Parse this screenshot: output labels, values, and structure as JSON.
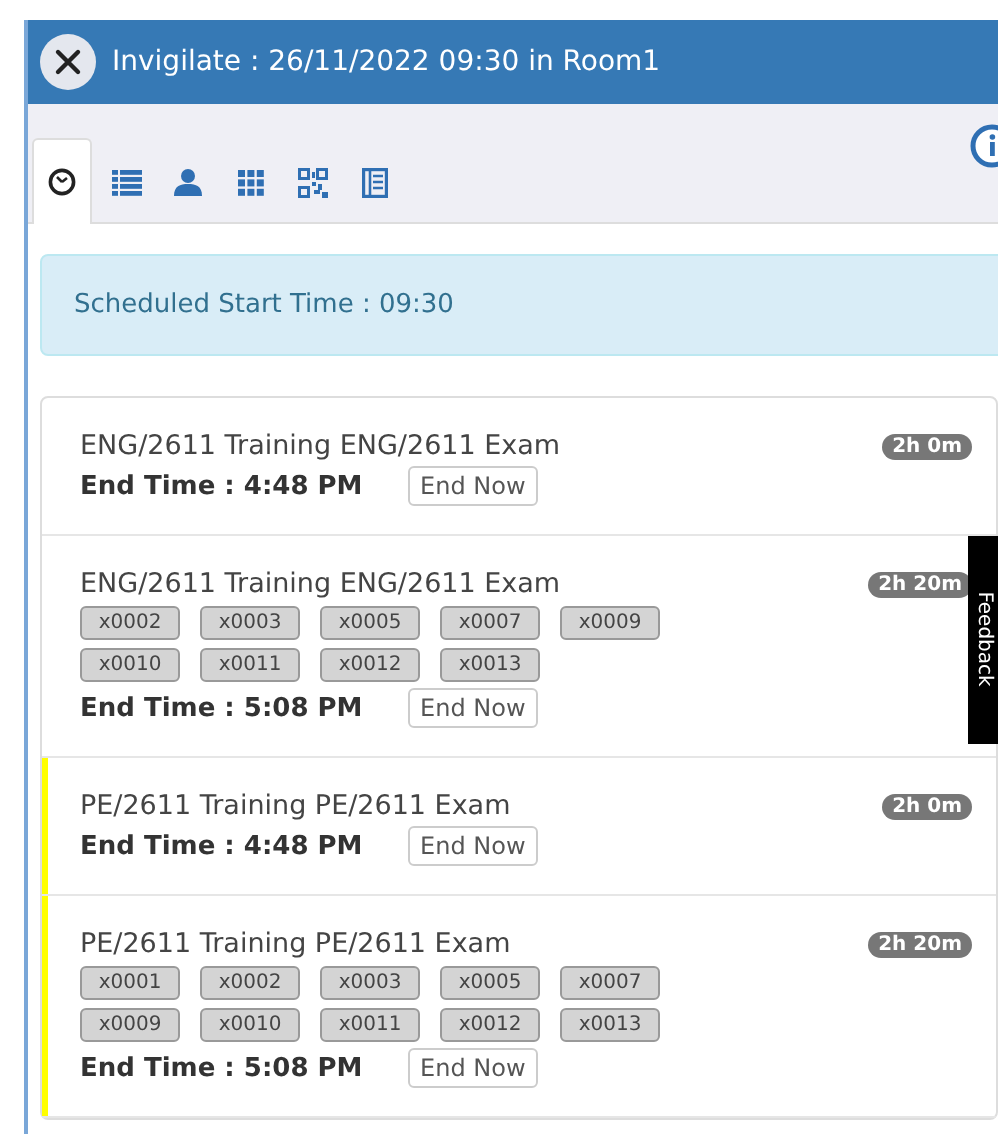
{
  "window": {
    "title": "Invigilate : 26/11/2022 09:30 in Room1"
  },
  "tabs": [
    {
      "selected": true
    },
    {
      "selected": false
    },
    {
      "selected": false
    },
    {
      "selected": false
    },
    {
      "selected": false
    },
    {
      "selected": false
    }
  ],
  "alert": {
    "text": "Scheduled Start Time : 09:30"
  },
  "exams": [
    {
      "title": "ENG/2611 Training ENG/2611 Exam",
      "duration": "2h 0m",
      "end_time": "End Time : 4:48 PM",
      "button": "End Now",
      "highlighted": false
    },
    {
      "title": "ENG/2611 Training ENG/2611 Exam",
      "duration": "2h 20m",
      "end_time": "End Time : 5:08 PM",
      "button": "End Now",
      "highlighted": false,
      "candidates": [
        "x0002",
        "x0003",
        "x0005",
        "x0007",
        "x0009",
        "x0010",
        "x0011",
        "x0012",
        "x0013"
      ]
    },
    {
      "title": "PE/2611 Training PE/2611 Exam",
      "duration": "2h 0m",
      "end_time": "End Time : 4:48 PM",
      "button": "End Now",
      "highlighted": true
    },
    {
      "title": "PE/2611 Training PE/2611 Exam",
      "duration": "2h 20m",
      "end_time": "End Time : 5:08 PM",
      "button": "End Now",
      "highlighted": true,
      "candidates": [
        "x0001",
        "x0002",
        "x0003",
        "x0005",
        "x0007",
        "x0009",
        "x0010",
        "x0011",
        "x0012",
        "x0013"
      ]
    }
  ],
  "feedback_tab": {
    "label": "Feedback"
  }
}
